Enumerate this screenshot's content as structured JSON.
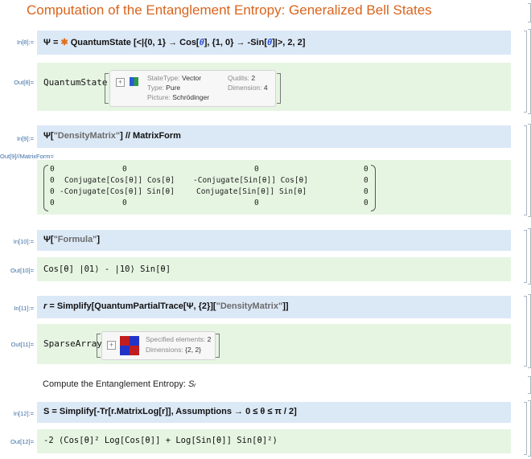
{
  "title": "Computation of the Entanglement Entropy: Generalized Bell States",
  "cells": {
    "in8": {
      "label": "In[8]:=",
      "code_prefix": "Ψ = ",
      "func": "QuantumState",
      "code_suffix_a": "[<|{0, 1} → Cos[",
      "theta": "θ",
      "code_suffix_b": "], {1, 0} → -Sin[",
      "code_suffix_c": "]|>, 2, 2]"
    },
    "out8": {
      "label": "Out[8]=",
      "head": "QuantumState",
      "summary": {
        "statetype_k": "StateType:",
        "statetype_v": "Vector",
        "type_k": "Type:",
        "type_v": "Pure",
        "picture_k": "Picture:",
        "picture_v": "Schrödinger",
        "qudits_k": "Qudits:",
        "qudits_v": "2",
        "dim_k": "Dimension:",
        "dim_v": "4"
      }
    },
    "in9": {
      "label": "In[9]:=",
      "a": "Ψ[",
      "str": "\"DensityMatrix\"",
      "b": "] // MatrixForm"
    },
    "out9": {
      "label": "Out[9]//MatrixForm=",
      "matrix": [
        [
          "0",
          "0",
          "0",
          "0"
        ],
        [
          "0",
          "Conjugate[Cos[θ]] Cos[θ]",
          "-Conjugate[Sin[θ]] Cos[θ]",
          "0"
        ],
        [
          "0",
          "-Conjugate[Cos[θ]] Sin[θ]",
          "Conjugate[Sin[θ]] Sin[θ]",
          "0"
        ],
        [
          "0",
          "0",
          "0",
          "0"
        ]
      ]
    },
    "in10": {
      "label": "In[10]:=",
      "a": "Ψ[",
      "str": "\"Formula\"",
      "b": "]"
    },
    "out10": {
      "label": "Out[10]=",
      "formula": "Cos[θ] |01⟩ - |10⟩ Sin[θ]"
    },
    "in11": {
      "label": "In[11]:=",
      "var": "r",
      "code": " = Simplify[QuantumPartialTrace[Ψ, {2}][",
      "str": "\"DensityMatrix\"",
      "end": "]]"
    },
    "out11": {
      "label": "Out[11]=",
      "head": "SparseArray",
      "spec_k": "Specified elements:",
      "spec_v": "2",
      "dims_k": "Dimensions:",
      "dims_v": "{2, 2}"
    },
    "text": {
      "content": "Compute the Entanglement Entropy: ",
      "sym": "Sᵣ"
    },
    "in12": {
      "label": "In[12]:=",
      "code": "S = Simplify[-Tr[r.MatrixLog[r]], Assumptions → 0 ≤ θ ≤ π / 2]"
    },
    "out12": {
      "label": "Out[12]=",
      "formula": "-2 (Cos[θ]² Log[Cos[θ]] + Log[Sin[θ]] Sin[θ]²)"
    }
  },
  "colors": {
    "title": "#d9641c",
    "input_bg": "#dbe8f6",
    "output_bg": "#e6f5e2",
    "label": "#3b6ea5"
  },
  "icons": [
    "quantum-state-icon",
    "bloch-matrix-icon",
    "sparse-matrix-icon",
    "expand-plus-icon"
  ]
}
